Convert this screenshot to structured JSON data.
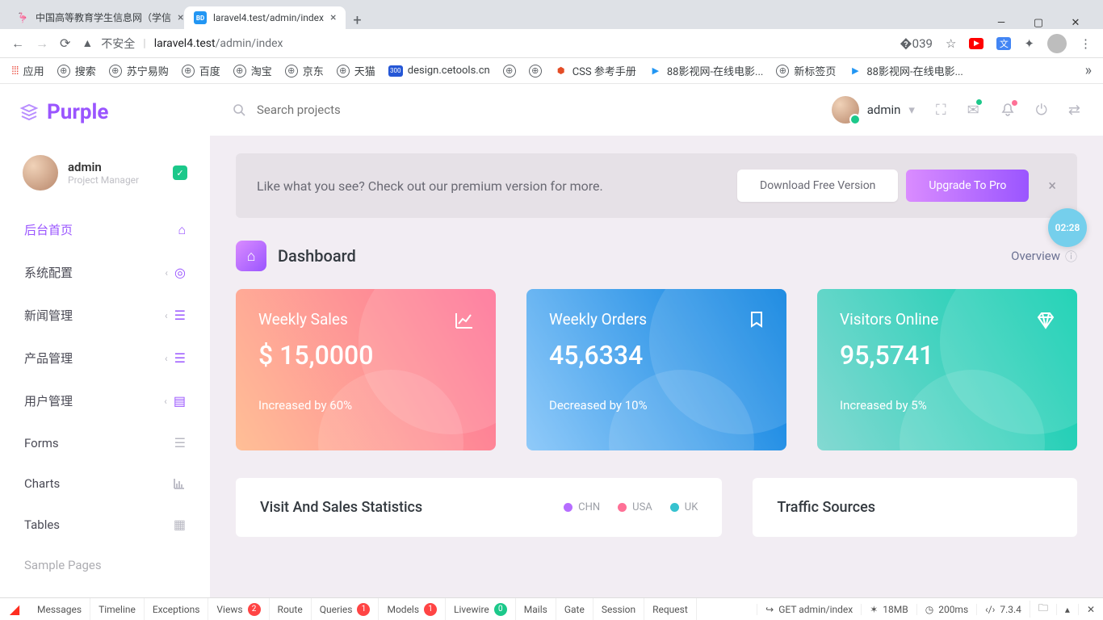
{
  "browser": {
    "tabs": [
      {
        "title": "中国高等教育学生信息网（学信",
        "active": false
      },
      {
        "title": "laravel4.test/admin/index",
        "active": true
      }
    ],
    "url_insecure_label": "不安全",
    "url_host": "laravel4.test",
    "url_path": "/admin/index",
    "bookmarks": {
      "apps": "应用",
      "items": [
        "搜索",
        "苏宁易购",
        "百度",
        "淘宝",
        "京东",
        "天猫"
      ],
      "cetools": "design.cetools.cn",
      "css_ref": "CSS 参考手册",
      "movie": "88影视网-在线电影...",
      "newtab": "新标签页",
      "movie2": "88影视网-在线电影..."
    }
  },
  "brand": "Purple",
  "search_placeholder": "Search projects",
  "user": {
    "name": "admin",
    "role": "Project Manager"
  },
  "sidebar": {
    "items": [
      {
        "label": "后台首页",
        "active": true,
        "icon": "home"
      },
      {
        "label": "系统配置",
        "icon": "target",
        "expandable": true
      },
      {
        "label": "新闻管理",
        "icon": "list",
        "expandable": true
      },
      {
        "label": "产品管理",
        "icon": "list",
        "expandable": true
      },
      {
        "label": "用户管理",
        "icon": "contact",
        "expandable": true
      },
      {
        "label": "Forms",
        "icon": "list"
      },
      {
        "label": "Charts",
        "icon": "chart"
      },
      {
        "label": "Tables",
        "icon": "table"
      },
      {
        "label": "Sample Pages",
        "icon": "page"
      }
    ]
  },
  "banner": {
    "text": "Like what you see? Check out our premium version for more.",
    "download": "Download Free Version",
    "upgrade": "Upgrade To Pro"
  },
  "page": {
    "title": "Dashboard",
    "overview": "Overview"
  },
  "time_bubble": "02:28",
  "cards": [
    {
      "title": "Weekly Sales",
      "value": "$ 15,0000",
      "delta": "Increased by 60%",
      "icon": "chart-line"
    },
    {
      "title": "Weekly Orders",
      "value": "45,6334",
      "delta": "Decreased by 10%",
      "icon": "bookmark"
    },
    {
      "title": "Visitors Online",
      "value": "95,5741",
      "delta": "Increased by 5%",
      "icon": "diamond"
    }
  ],
  "panels": {
    "stats_title": "Visit And Sales Statistics",
    "legend": [
      {
        "label": "CHN",
        "color": "#b66dff"
      },
      {
        "label": "USA",
        "color": "#fe7096"
      },
      {
        "label": "UK",
        "color": "#36c2cf"
      }
    ],
    "traffic_title": "Traffic Sources"
  },
  "debugbar": {
    "route": "GET admin/index",
    "mem": "18MB",
    "time": "200ms",
    "php": "7.3.4",
    "tabs": [
      {
        "label": "Messages"
      },
      {
        "label": "Timeline"
      },
      {
        "label": "Exceptions"
      },
      {
        "label": "Views",
        "badge": "2"
      },
      {
        "label": "Route"
      },
      {
        "label": "Queries",
        "badge": "1"
      },
      {
        "label": "Models",
        "badge": "1"
      },
      {
        "label": "Livewire",
        "badge": "0"
      },
      {
        "label": "Mails"
      },
      {
        "label": "Gate"
      },
      {
        "label": "Session"
      },
      {
        "label": "Request"
      }
    ]
  }
}
